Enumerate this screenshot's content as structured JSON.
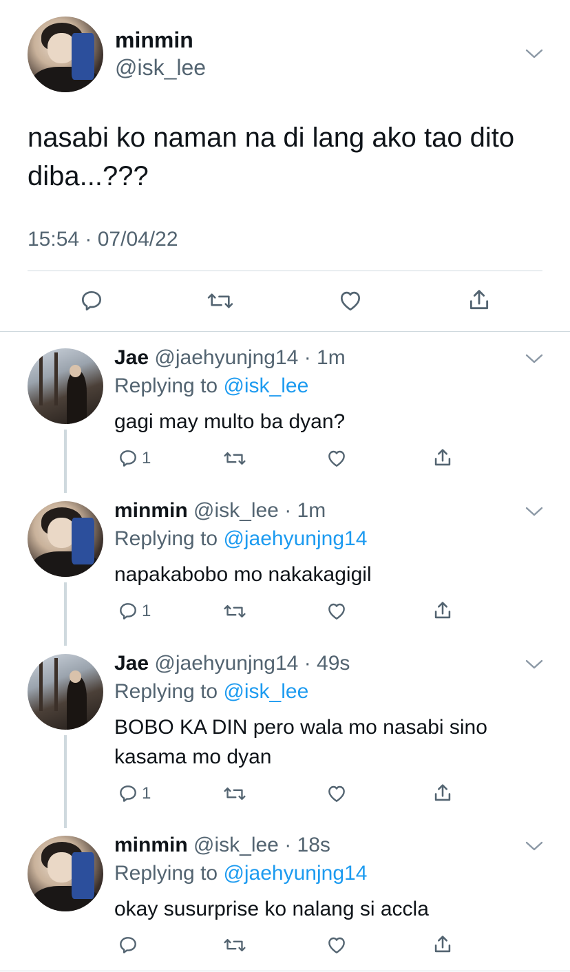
{
  "main_tweet": {
    "display_name": "minmin",
    "handle": "@isk_lee",
    "text": "nasabi ko naman na di lang ako tao dito diba...???",
    "timestamp": "15:54 · 07/04/22"
  },
  "replies": [
    {
      "display_name": "Jae",
      "handle": "@jaehyunjng14",
      "time": "· 1m",
      "replying_prefix": "Replying to",
      "replying_to": "@isk_lee",
      "text": "gagi may multo ba dyan?",
      "reply_count": "1"
    },
    {
      "display_name": "minmin",
      "handle": "@isk_lee",
      "time": "· 1m",
      "replying_prefix": "Replying to",
      "replying_to": "@jaehyunjng14",
      "text": "napakabobo mo nakakagigil",
      "reply_count": "1"
    },
    {
      "display_name": "Jae",
      "handle": "@jaehyunjng14",
      "time": "· 49s",
      "replying_prefix": "Replying to",
      "replying_to": "@isk_lee",
      "text": "BOBO KA DIN pero wala mo nasabi sino kasama mo dyan",
      "reply_count": "1"
    },
    {
      "display_name": "minmin",
      "handle": "@isk_lee",
      "time": "· 18s",
      "replying_prefix": "Replying to",
      "replying_to": "@jaehyunjng14",
      "text": "okay susurprise ko nalang si accla",
      "reply_count": ""
    }
  ],
  "icons": {
    "reply": "reply-icon",
    "retweet": "retweet-icon",
    "like": "like-icon",
    "share": "share-icon",
    "more": "chevron-down-icon"
  },
  "colors": {
    "text": "#0f1419",
    "secondary": "#536471",
    "mention": "#1d9bf0",
    "divider": "#cfd9de"
  }
}
